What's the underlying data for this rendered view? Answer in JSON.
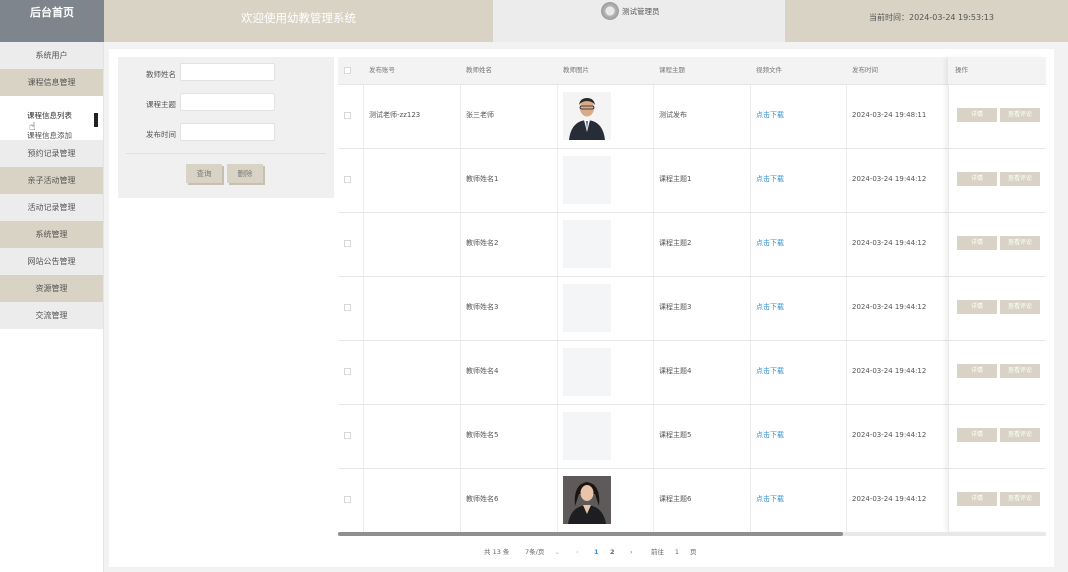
{
  "header": {
    "home": "后台首页",
    "welcome": "欢迎使用幼教管理系统",
    "user": "测试管理员",
    "time_label": "当前时间：",
    "time_value": "2024-03-24 19:53:13"
  },
  "sidebar": {
    "items": [
      "系统用户",
      "课程信息管理",
      "预约记录管理",
      "亲子活动管理",
      "活动记录管理",
      "系统管理",
      "网站公告管理",
      "资源管理",
      "交流管理"
    ],
    "sub_items": [
      "课程信息列表",
      "课程信息添加"
    ]
  },
  "search": {
    "fields": [
      "教师姓名",
      "课程主题",
      "发布时间"
    ],
    "query_button": "查询",
    "delete_button": "删除"
  },
  "table": {
    "columns": [
      "发布账号",
      "教师姓名",
      "教师图片",
      "课程主题",
      "视频文件",
      "发布时间",
      "操作"
    ],
    "rows": [
      {
        "account": "测试老师-zz123",
        "teacher": "张三老师",
        "photo": "man",
        "topic": "测试发布",
        "video": "点击下载",
        "time": "2024-03-24 19:48:11"
      },
      {
        "account": "",
        "teacher": "教师姓名1",
        "photo": "blank",
        "topic": "课程主题1",
        "video": "点击下载",
        "time": "2024-03-24 19:44:12"
      },
      {
        "account": "",
        "teacher": "教师姓名2",
        "photo": "blank",
        "topic": "课程主题2",
        "video": "点击下载",
        "time": "2024-03-24 19:44:12"
      },
      {
        "account": "",
        "teacher": "教师姓名3",
        "photo": "blank",
        "topic": "课程主题3",
        "video": "点击下载",
        "time": "2024-03-24 19:44:12"
      },
      {
        "account": "",
        "teacher": "教师姓名4",
        "photo": "blank",
        "topic": "课程主题4",
        "video": "点击下载",
        "time": "2024-03-24 19:44:12"
      },
      {
        "account": "",
        "teacher": "教师姓名5",
        "photo": "blank",
        "topic": "课程主题5",
        "video": "点击下载",
        "time": "2024-03-24 19:44:12"
      },
      {
        "account": "",
        "teacher": "教师姓名6",
        "photo": "woman",
        "topic": "课程主题6",
        "video": "点击下载",
        "time": "2024-03-24 19:44:12"
      }
    ],
    "actions": [
      "详情",
      "查看评论"
    ]
  },
  "pagination": {
    "total": "共 13 条",
    "page_size": "7条/页",
    "pages": [
      "1",
      "2"
    ],
    "goto_label": "前往",
    "goto_value": "1",
    "page_unit": "页"
  }
}
